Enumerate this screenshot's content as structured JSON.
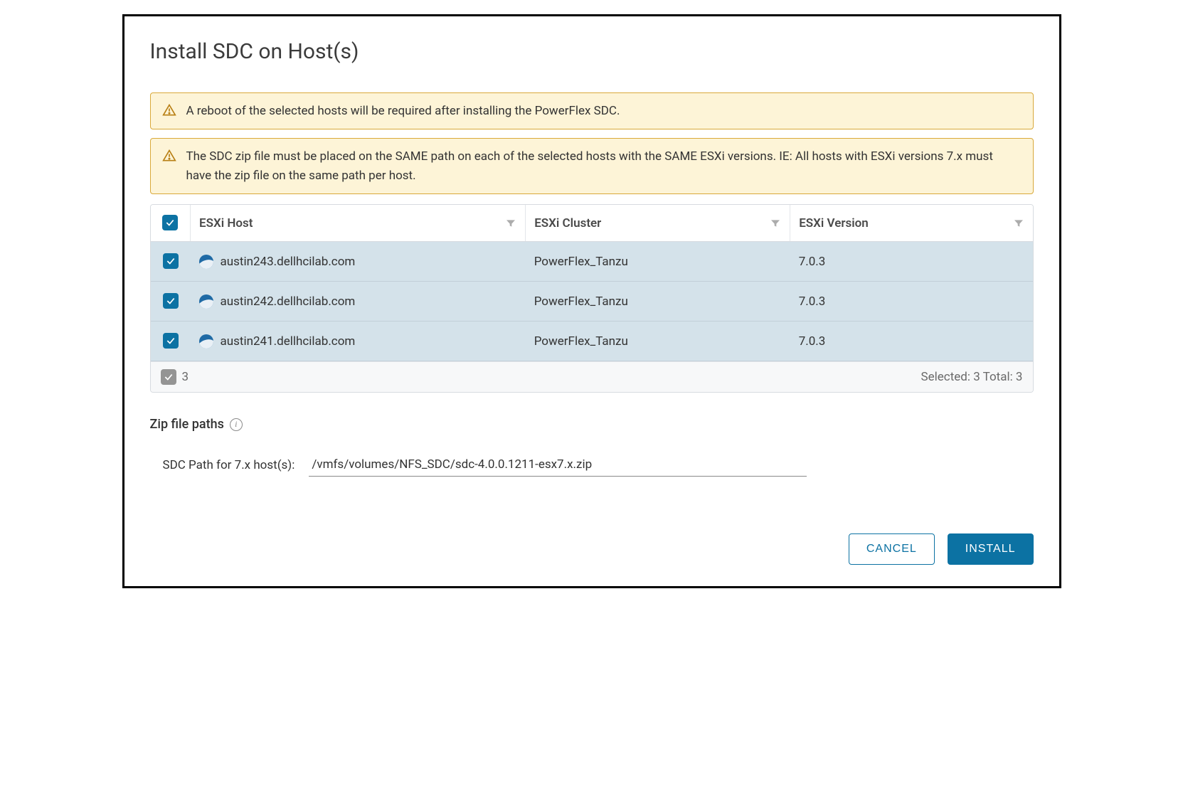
{
  "dialog": {
    "title": "Install SDC on Host(s)"
  },
  "alerts": [
    {
      "text": "A reboot of the selected hosts will be required after installing the PowerFlex SDC."
    },
    {
      "text": "The SDC zip file must be placed on the SAME path on each of the selected hosts with the SAME ESXi versions. IE: All hosts with ESXi versions 7.x must have the zip file on the same path per host."
    }
  ],
  "table": {
    "columns": {
      "host": "ESXi Host",
      "cluster": "ESXi Cluster",
      "version": "ESXi Version"
    },
    "rows": [
      {
        "host": "austin243.dellhcilab.com",
        "cluster": "PowerFlex_Tanzu",
        "version": "7.0.3",
        "checked": true
      },
      {
        "host": "austin242.dellhcilab.com",
        "cluster": "PowerFlex_Tanzu",
        "version": "7.0.3",
        "checked": true
      },
      {
        "host": "austin241.dellhcilab.com",
        "cluster": "PowerFlex_Tanzu",
        "version": "7.0.3",
        "checked": true
      }
    ],
    "footer": {
      "count": "3",
      "summary": "Selected: 3 Total: 3"
    }
  },
  "paths": {
    "section_label": "Zip file paths",
    "row_label": "SDC Path for 7.x host(s):",
    "value": "/vmfs/volumes/NFS_SDC/sdc-4.0.0.1211-esx7.x.zip"
  },
  "actions": {
    "cancel": "CANCEL",
    "install": "INSTALL"
  }
}
